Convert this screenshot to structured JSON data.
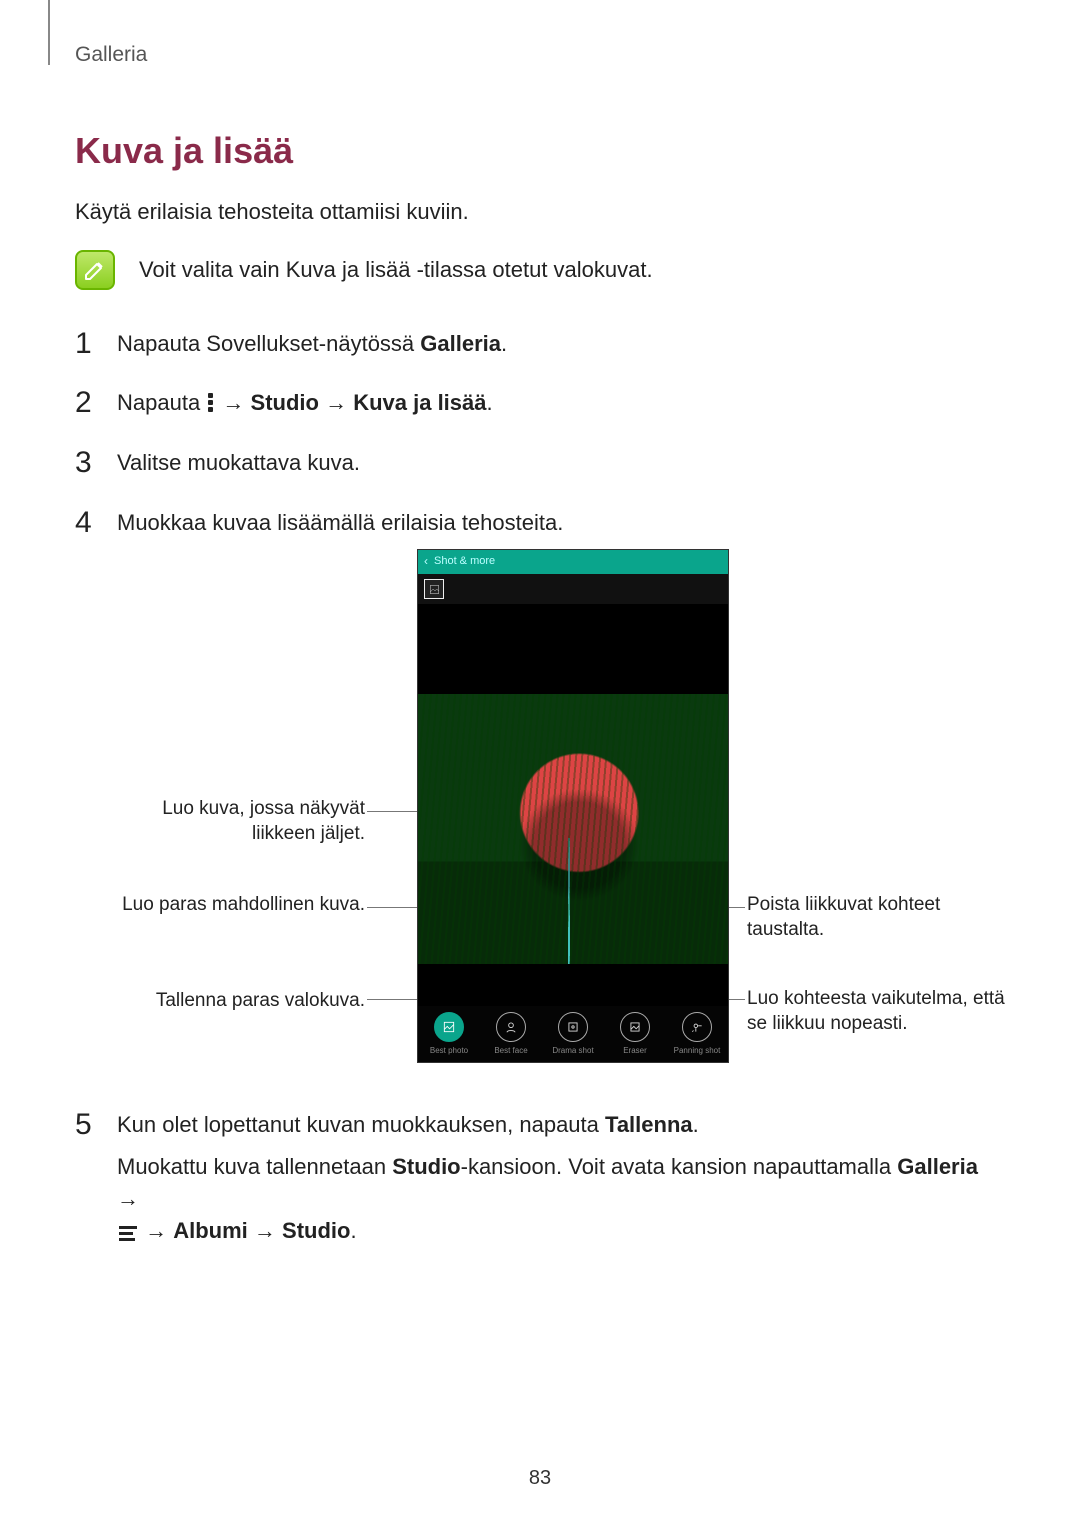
{
  "breadcrumb": "Galleria",
  "title": "Kuva ja lisää",
  "intro": "Käytä erilaisia tehosteita ottamiisi kuviin.",
  "note": "Voit valita vain Kuva ja lisää -tilassa otetut valokuvat.",
  "steps": {
    "s1_pre": "Napauta Sovellukset-näytössä ",
    "s1_bold": "Galleria",
    "s1_post": ".",
    "s2_pre": "Napauta ",
    "s2_arrow1": " → ",
    "s2_b1": "Studio",
    "s2_arrow2": " → ",
    "s2_b2": "Kuva ja lisää",
    "s2_post": ".",
    "s3": "Valitse muokattava kuva.",
    "s4": "Muokkaa kuvaa lisäämällä erilaisia tehosteita.",
    "s5_line1_pre": "Kun olet lopettanut kuvan muokkauksen, napauta ",
    "s5_line1_b": "Tallenna",
    "s5_line1_post": ".",
    "s5_line2_pre": "Muokattu kuva tallennetaan ",
    "s5_line2_b1": "Studio",
    "s5_line2_mid": "-kansioon. Voit avata kansion napauttamalla ",
    "s5_line2_b2": "Galleria",
    "s5_line2_arrow1": " → ",
    "s5_line3_arrow1": " → ",
    "s5_line3_b1": "Albumi",
    "s5_line3_arrow2": " → ",
    "s5_line3_b2": "Studio",
    "s5_line3_post": "."
  },
  "callouts": {
    "left1": "Luo kuva, jossa näkyvät liikkeen jäljet.",
    "left2": "Luo paras mahdollinen kuva.",
    "left3": "Tallenna paras valokuva.",
    "right1": "Poista liikkuvat kohteet taustalta.",
    "right2": "Luo kohteesta vaikutelma, että se liikkuu nopeasti."
  },
  "phone": {
    "header": "Shot & more",
    "tools": [
      "Best photo",
      "Best face",
      "Drama shot",
      "Eraser",
      "Panning shot"
    ]
  },
  "pageNumber": "83"
}
